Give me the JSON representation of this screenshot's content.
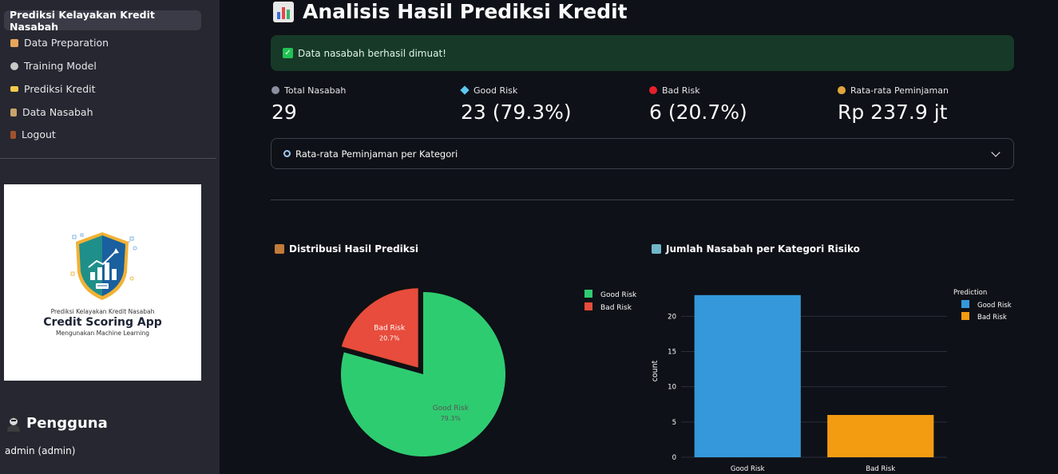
{
  "sidebar": {
    "items": [
      {
        "label": "Prediksi Kelayakan Kredit Nasabah",
        "icon": "none"
      },
      {
        "label": "Data Preparation",
        "icon": "house-icon"
      },
      {
        "label": "Training Model",
        "icon": "gear-icon"
      },
      {
        "label": "Prediksi Kredit",
        "icon": "credit-card-icon"
      },
      {
        "label": "Data Nasabah",
        "icon": "clipboard-icon"
      },
      {
        "label": "Logout",
        "icon": "door-icon"
      }
    ],
    "logo": {
      "line1": "Prediksi Kelayakan Kredit Nasabah",
      "line2": "Credit Scoring App",
      "line3": "Mengunakan Machine Learning"
    },
    "user_heading": "Pengguna",
    "user_name": "admin (admin)"
  },
  "main": {
    "title": "Analisis Hasil Prediksi Kredit",
    "alert": "Data nasabah berhasil dimuat!",
    "metrics": [
      {
        "label": "Total Nasabah",
        "value": "29",
        "icon": "people-icon"
      },
      {
        "label": "Good Risk",
        "value": "23 (79.3%)",
        "icon": "diamond-icon"
      },
      {
        "label": "Bad Risk",
        "value": "6 (20.7%)",
        "icon": "red-circle-icon"
      },
      {
        "label": "Rata-rata Peminjaman",
        "value": "Rp 237.9 jt",
        "icon": "money-bag-icon"
      }
    ],
    "expander_label": "Rata-rata Peminjaman per Kategori",
    "pie_title": "Distribusi Hasil Prediksi",
    "bar_title": "Jumlah Nasabah per Kategori Risiko"
  },
  "colors": {
    "good": "#2ecc71",
    "bad": "#e74c3c",
    "bar_good": "#3498db",
    "bar_bad": "#f39c12",
    "success_bg": "#173928"
  },
  "chart_data": [
    {
      "type": "pie",
      "title": "Distribusi Hasil Prediksi",
      "categories": [
        "Good Risk",
        "Bad Risk"
      ],
      "values": [
        79.3,
        20.7
      ],
      "value_labels": [
        "79.3%",
        "20.7%"
      ],
      "legend": [
        "Good Risk",
        "Bad Risk"
      ],
      "legend_position": "right"
    },
    {
      "type": "bar",
      "title": "Jumlah Nasabah per Kategori Risiko",
      "categories": [
        "Good Risk",
        "Bad Risk"
      ],
      "values": [
        23,
        6
      ],
      "ylabel": "count",
      "xlabel": "",
      "ylim": [
        0,
        24
      ],
      "yticks": [
        0,
        5,
        10,
        15,
        20
      ],
      "legend_title": "Prediction",
      "legend": [
        "Good Risk",
        "Bad Risk"
      ],
      "legend_position": "right",
      "grid": true
    }
  ]
}
